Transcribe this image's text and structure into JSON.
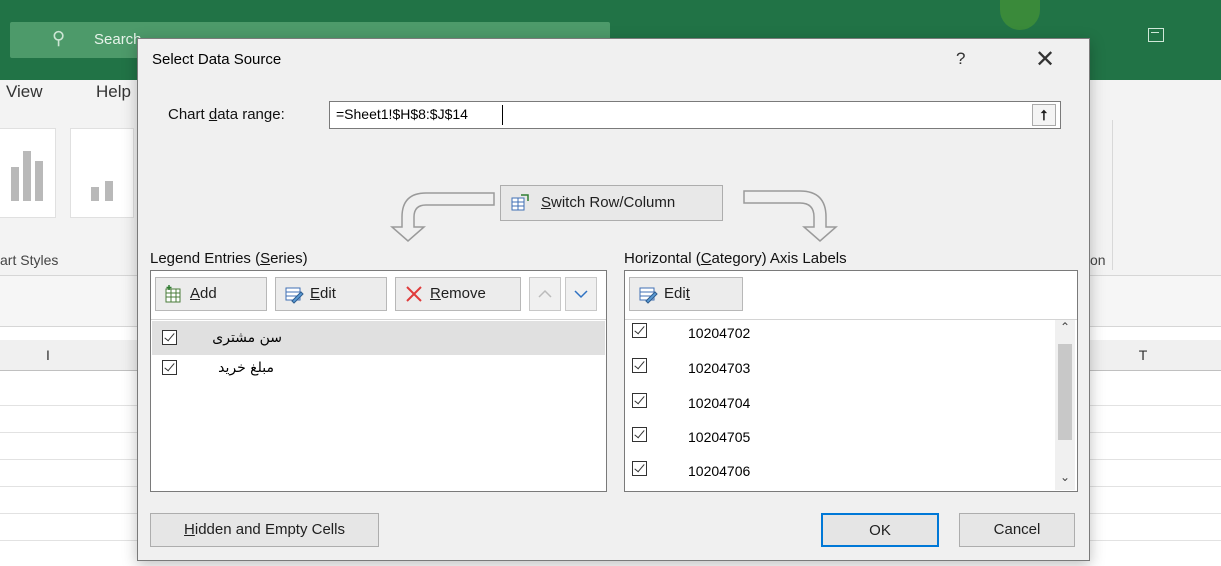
{
  "excel": {
    "search_placeholder": "Search",
    "tabs": [
      "View",
      "Help"
    ],
    "styles_group_label": "art Styles",
    "right_group_label_fragment": "on",
    "column_headers": [
      "I",
      "T"
    ]
  },
  "dialog": {
    "title": "Select Data Source",
    "help": "?",
    "close": "✕",
    "data_range": {
      "label_pre": "Chart ",
      "label_mnemonic": "d",
      "label_post": "ata range:",
      "value": "=Sheet1!$H$8:$J$14"
    },
    "switch_button": {
      "pre": "",
      "mnemonic": "S",
      "post": "witch Row/Column"
    },
    "legend": {
      "label_pre": "Legend Entries (",
      "label_mnemonic": "S",
      "label_post": "eries)",
      "toolbar": {
        "add": {
          "mnemonic": "A",
          "post": "dd"
        },
        "edit": {
          "mnemonic": "E",
          "post": "dit"
        },
        "remove": {
          "mnemonic": "R",
          "post": "emove"
        }
      },
      "series": [
        {
          "name": "سن مشتری",
          "checked": true,
          "selected": true
        },
        {
          "name": "مبلغ خرید",
          "checked": true,
          "selected": false
        }
      ]
    },
    "axis": {
      "label_pre": "Horizontal (",
      "label_mnemonic": "C",
      "label_post": "ategory) Axis Labels",
      "toolbar": {
        "edit": {
          "pre": "Edi",
          "mnemonic": "t"
        }
      },
      "labels": [
        "10204702",
        "10204703",
        "10204704",
        "10204705",
        "10204706"
      ]
    },
    "buttons": {
      "hidden": {
        "mnemonic": "H",
        "post": "idden and Empty Cells"
      },
      "ok": "OK",
      "cancel": "Cancel"
    }
  }
}
